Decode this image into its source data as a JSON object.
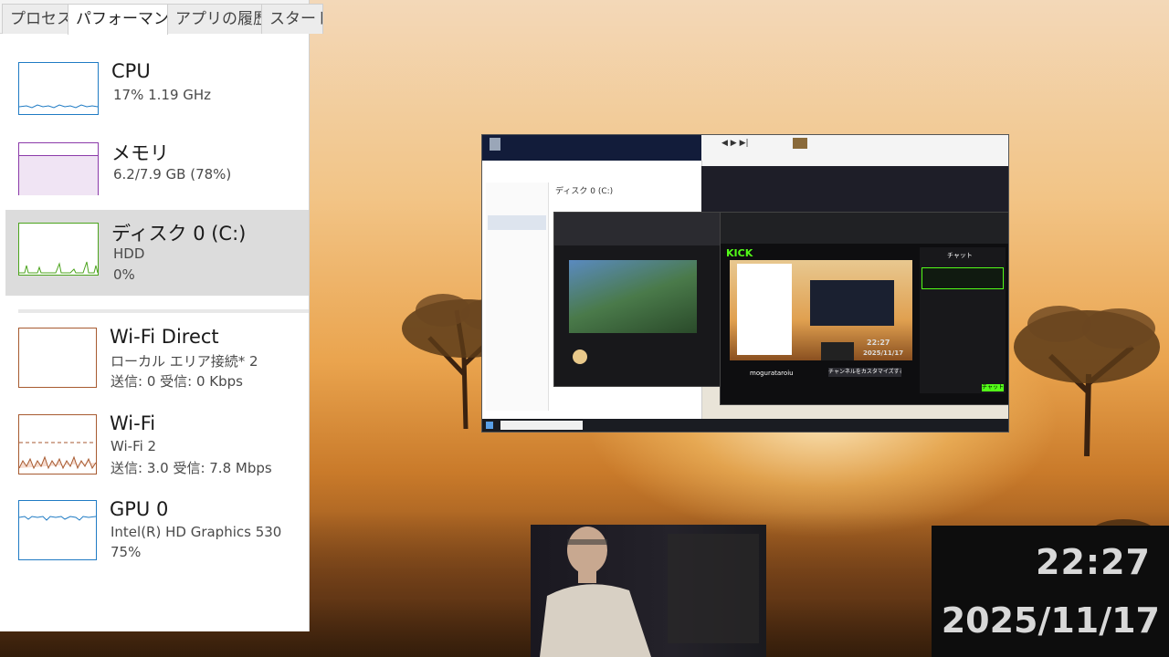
{
  "taskmanager": {
    "tabs": [
      "プロセス",
      "パフォーマンス",
      "アプリの履歴",
      "スタート"
    ],
    "items": [
      {
        "title": "CPU",
        "sub1": "17%  1.19 GHz",
        "color": "#1f7bc4"
      },
      {
        "title": "メモリ",
        "sub1": "6.2/7.9 GB (78%)",
        "color": "#8b3aa9"
      },
      {
        "title": "ディスク 0 (C:)",
        "sub1": "HDD",
        "sub2": "0%",
        "color": "#4ca41d"
      },
      {
        "title": "Wi-Fi Direct",
        "sub1": "ローカル エリア接続* 2",
        "sub2": "送信: 0 受信: 0 Kbps",
        "color": "#a75a30"
      },
      {
        "title": "Wi-Fi",
        "sub1": "Wi-Fi 2",
        "sub2": "送信: 3.0 受信: 7.8 Mbps",
        "color": "#a75a30"
      },
      {
        "title": "GPU 0",
        "sub1": "Intel(R) HD Graphics 530",
        "sub2": "75%",
        "color": "#1f7bc4"
      }
    ]
  },
  "nested_screen": {
    "disk_heading": "ディスク 0 (C:)",
    "kick_brand": "KICK",
    "streamer": "mogurataroiu",
    "chat_title": "チャット",
    "customize_btn": "チャンネルをカスタマイズする。",
    "chat_button": "チャット",
    "overlay_time": "22:27",
    "overlay_date": "2025/11/17"
  },
  "clock": {
    "time": "22:27",
    "date": "2025/11/17"
  }
}
